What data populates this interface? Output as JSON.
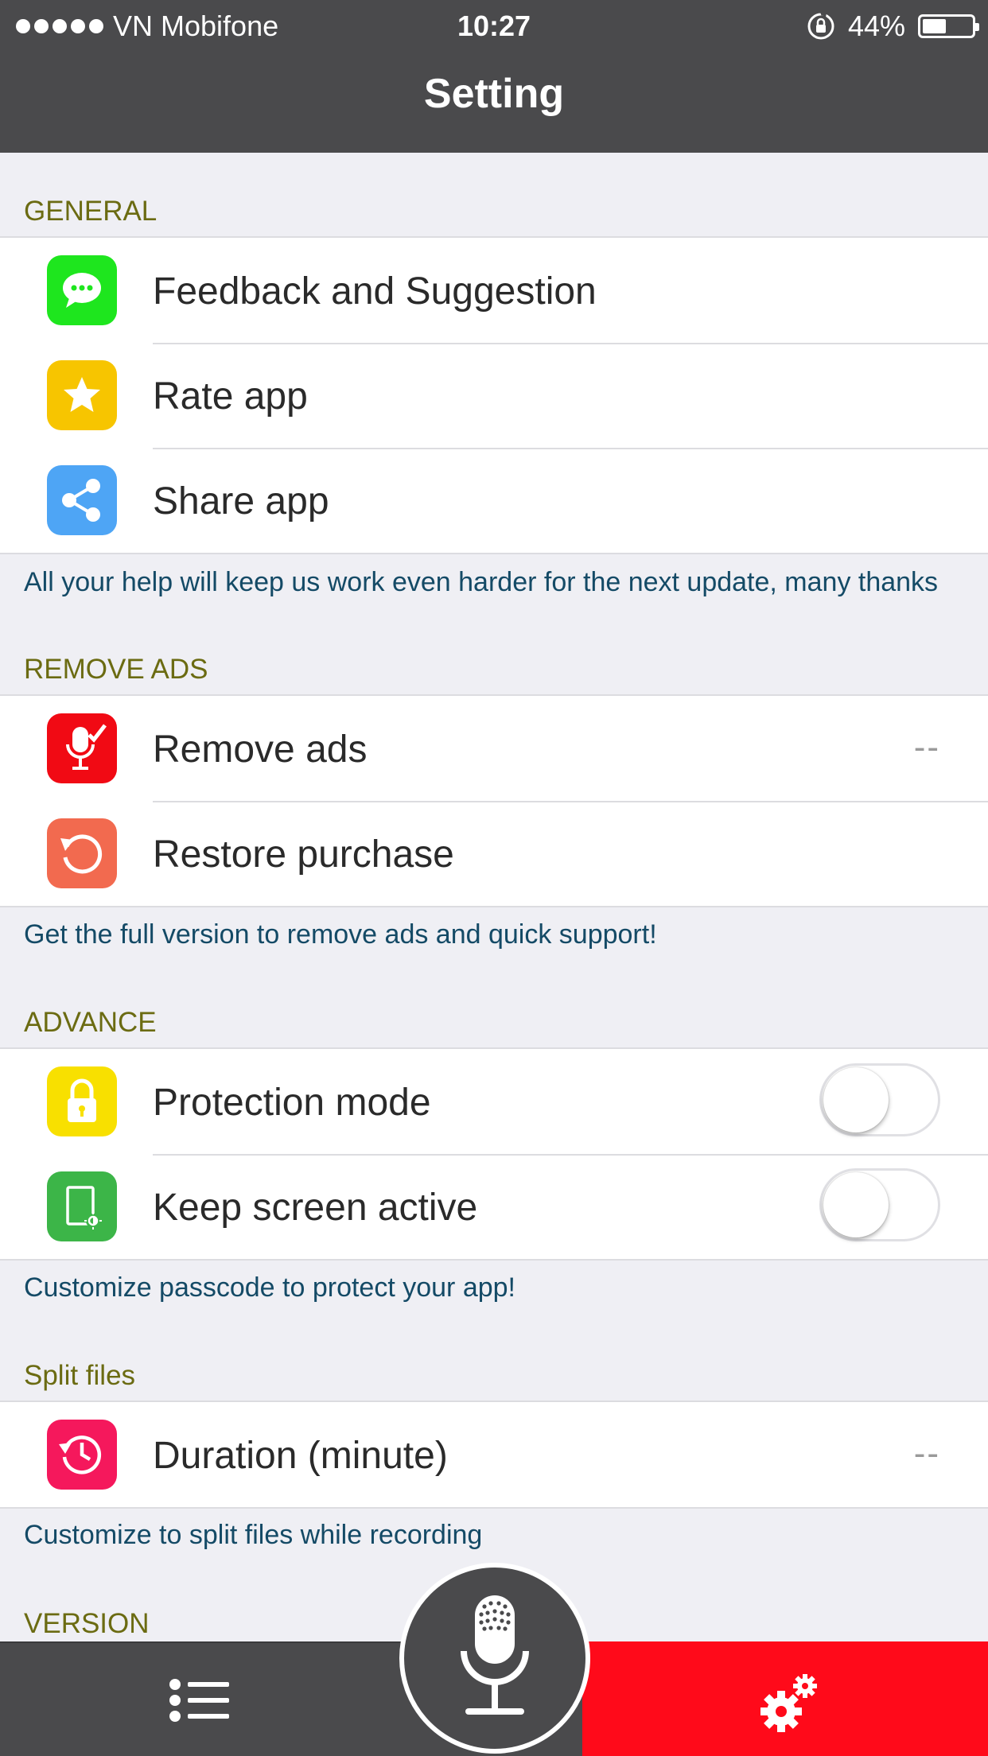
{
  "status_bar": {
    "carrier": "VN Mobifone",
    "time": "10:27",
    "battery": "44%",
    "battery_level": 0.44
  },
  "nav": {
    "title": "Setting"
  },
  "sections": {
    "general": {
      "header": "GENERAL",
      "items": [
        {
          "label": "Feedback and Suggestion",
          "icon": "message-bubble-icon",
          "color": "#1ee61e"
        },
        {
          "label": "Rate app",
          "icon": "star-icon",
          "color": "#f7c500"
        },
        {
          "label": "Share app",
          "icon": "share-icon",
          "color": "#4ea5f5"
        }
      ],
      "footer": "All your help will keep us work even harder for the next update, many thanks"
    },
    "remove_ads": {
      "header": "REMOVE ADS",
      "items": [
        {
          "label": "Remove ads",
          "value": "--",
          "icon": "mic-check-icon",
          "color": "#f10a14"
        },
        {
          "label": "Restore purchase",
          "icon": "restore-icon",
          "color": "#f26a4f"
        }
      ],
      "footer": "Get the full version to remove ads and quick support!"
    },
    "advance": {
      "header": "ADVANCE",
      "items": [
        {
          "label": "Protection mode",
          "toggle": false,
          "icon": "lock-icon",
          "color": "#f8e000"
        },
        {
          "label": "Keep screen active",
          "toggle": false,
          "icon": "screen-brightness-icon",
          "color": "#3cb548"
        }
      ],
      "footer": "Customize passcode to protect your app!"
    },
    "split_files": {
      "header": "Split files",
      "items": [
        {
          "label": "Duration (minute)",
          "value": "--",
          "icon": "timer-history-icon",
          "color": "#f5185c"
        }
      ],
      "footer": "Customize to split files while recording"
    },
    "version": {
      "header": "VERSION"
    }
  },
  "tabbar": {
    "items": [
      "list-icon",
      "microphone-icon",
      "settings-gears-icon"
    ],
    "active_color": "#ff0a1a"
  }
}
